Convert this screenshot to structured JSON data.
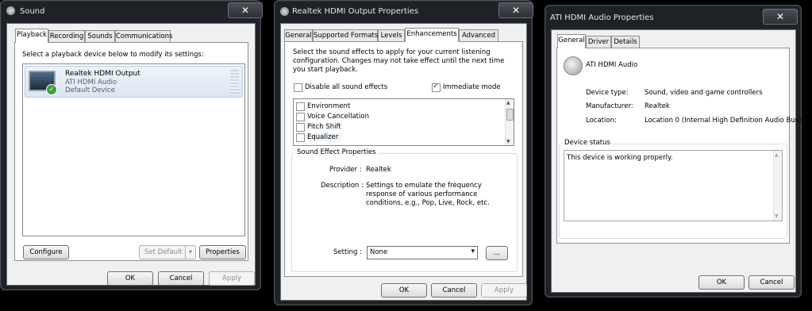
{
  "sound": {
    "title": "Sound",
    "tabs": [
      "Playback",
      "Recording",
      "Sounds",
      "Communications"
    ],
    "instruction": "Select a playback device below to modify its settings:",
    "device": {
      "name": "Realtek HDMI Output",
      "driver": "ATI HDMI Audio",
      "status": "Default Device"
    },
    "configure_label": "Configure",
    "set_default_label": "Set Default",
    "properties_label": "Properties",
    "ok_label": "OK",
    "cancel_label": "Cancel",
    "apply_label": "Apply"
  },
  "realtek": {
    "title": "Realtek HDMI Output Properties",
    "tabs": [
      "General",
      "Supported Formats",
      "Levels",
      "Enhancements",
      "Advanced"
    ],
    "description": "Select the sound effects to apply for your current listening configuration. Changes may not take effect until the next time you start playback.",
    "disable_all_label": "Disable all sound effects",
    "immediate_label": "Immediate mode",
    "effects": [
      "Environment",
      "Voice Cancellation",
      "Pitch Shift",
      "Equalizer"
    ],
    "group_label": "Sound Effect Properties",
    "provider_label": "Provider :",
    "provider_value": "Realtek",
    "desc_label": "Description :",
    "desc_value": "Settings to emulate the frequency response of various performance conditions,  e.g., Pop, Live, Rock, etc.",
    "setting_label": "Setting :",
    "setting_value": "None",
    "more_label": "...",
    "ok_label": "OK",
    "cancel_label": "Cancel",
    "apply_label": "Apply"
  },
  "ati": {
    "title": "ATI HDMI Audio Properties",
    "tabs": [
      "General",
      "Driver",
      "Details"
    ],
    "device_name": "ATI HDMI Audio",
    "type_label": "Device type:",
    "type_value": "Sound, video and game controllers",
    "manufacturer_label": "Manufacturer:",
    "manufacturer_value": "Realtek",
    "location_label": "Location:",
    "location_value": "Location 0 (Internal High Definition Audio Bus)",
    "status_group_label": "Device status",
    "status_text": "This device is working properly.",
    "ok_label": "OK",
    "cancel_label": "Cancel"
  },
  "close_glyph": "✕"
}
